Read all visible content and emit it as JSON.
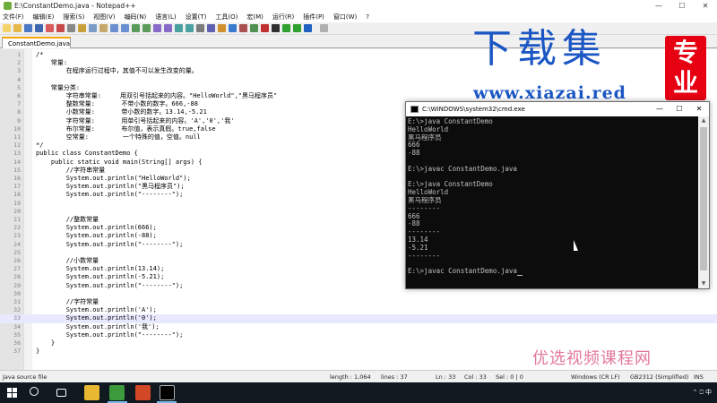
{
  "notepad": {
    "title": "E:\\ConstantDemo.java - Notepad++",
    "win_buttons": [
      "—",
      "☐",
      "✕"
    ],
    "menu": [
      "文件(F)",
      "编辑(E)",
      "搜索(S)",
      "视图(V)",
      "编码(N)",
      "语言(L)",
      "设置(T)",
      "工具(O)",
      "宏(M)",
      "运行(R)",
      "插件(P)",
      "窗口(W)",
      "?"
    ],
    "tab": "ConstantDemo.java",
    "lines": [
      {
        "n": "1",
        "t": "/*",
        "cls": "c-comment"
      },
      {
        "n": "2",
        "t": "    常量:",
        "cls": "c-comment"
      },
      {
        "n": "3",
        "t": "        在程序运行过程中，其值不可以发生改变的量。",
        "cls": "c-comment"
      },
      {
        "n": "4",
        "t": "",
        "cls": "c-comment"
      },
      {
        "n": "5",
        "t": "    常量分类:",
        "cls": "c-comment"
      },
      {
        "n": "6",
        "t": "        字符串常量:     用双引号括起来的内容。\"HelloWorld\",\"黑马程序员\"",
        "cls": "c-comment"
      },
      {
        "n": "7",
        "t": "        整数常量:       不带小数的数字。666,-88",
        "cls": "c-comment"
      },
      {
        "n": "8",
        "t": "        小数常量:       带小数的数字。13.14,-5.21",
        "cls": "c-comment"
      },
      {
        "n": "9",
        "t": "        字符常量:       用单引号括起来的内容。'A','0','我'",
        "cls": "c-comment"
      },
      {
        "n": "10",
        "t": "        布尔常量:       布尔值，表示真假。true,false",
        "cls": "c-comment"
      },
      {
        "n": "11",
        "t": "        空常量:         一个特殊的值，空值。null",
        "cls": "c-comment"
      },
      {
        "n": "12",
        "t": "*/",
        "cls": "c-comment"
      },
      {
        "n": "13",
        "t": "public class ConstantDemo {",
        "cls": ""
      },
      {
        "n": "14",
        "t": "    public static void main(String[] args) {",
        "cls": ""
      },
      {
        "n": "15",
        "t": "        //字符串常量",
        "cls": "c-comment"
      },
      {
        "n": "16",
        "t": "        System.out.println(\"HelloWorld\");",
        "cls": ""
      },
      {
        "n": "17",
        "t": "        System.out.println(\"黑马程序员\");",
        "cls": ""
      },
      {
        "n": "18",
        "t": "        System.out.println(\"--------\");",
        "cls": ""
      },
      {
        "n": "19",
        "t": "",
        "cls": ""
      },
      {
        "n": "20",
        "t": "",
        "cls": ""
      },
      {
        "n": "21",
        "t": "        //整数常量",
        "cls": "c-comment"
      },
      {
        "n": "22",
        "t": "        System.out.println(666);",
        "cls": ""
      },
      {
        "n": "23",
        "t": "        System.out.println(-88);",
        "cls": ""
      },
      {
        "n": "24",
        "t": "        System.out.println(\"--------\");",
        "cls": ""
      },
      {
        "n": "25",
        "t": "",
        "cls": ""
      },
      {
        "n": "26",
        "t": "        //小数常量",
        "cls": "c-comment"
      },
      {
        "n": "27",
        "t": "        System.out.println(13.14);",
        "cls": ""
      },
      {
        "n": "28",
        "t": "        System.out.println(-5.21);",
        "cls": ""
      },
      {
        "n": "29",
        "t": "        System.out.println(\"--------\");",
        "cls": ""
      },
      {
        "n": "30",
        "t": "",
        "cls": ""
      },
      {
        "n": "31",
        "t": "        //字符常量",
        "cls": "c-comment"
      },
      {
        "n": "32",
        "t": "        System.out.println('A');",
        "cls": ""
      },
      {
        "n": "33",
        "t": "        System.out.println('0');",
        "cls": "current"
      },
      {
        "n": "34",
        "t": "        System.out.println('我');",
        "cls": ""
      },
      {
        "n": "35",
        "t": "        System.out.println(\"--------\");",
        "cls": ""
      },
      {
        "n": "36",
        "t": "    }",
        "cls": ""
      },
      {
        "n": "37",
        "t": "}",
        "cls": ""
      }
    ],
    "status": {
      "type": "Java source file",
      "length": "length : 1,064",
      "lines": "lines : 37",
      "ln": "Ln : 33",
      "col": "Col : 33",
      "sel": "Sel : 0 | 0",
      "eol": "Windows (CR LF)",
      "encoding": "GB2312 (Simplified)",
      "mode": "INS"
    }
  },
  "cmd": {
    "title": "C:\\WINDOWS\\system32\\cmd.exe",
    "win_buttons": [
      "—",
      "☐",
      "✕"
    ],
    "output": [
      "E:\\>java ConstantDemo",
      "HelloWorld",
      "黑马程序员",
      "666",
      "-88",
      "",
      "E:\\>javac ConstantDemo.java",
      "",
      "E:\\>java ConstantDemo",
      "HelloWorld",
      "黑马程序员",
      "--------",
      "666",
      "-88",
      "--------",
      "13.14",
      "-5.21",
      "--------",
      "",
      "E:\\>javac ConstantDemo.java"
    ]
  },
  "watermark": {
    "title": "下载集",
    "url": "www.xiazai.red",
    "seal": "专业",
    "course": "优选视频课程网"
  },
  "taskbar": {
    "tray": "⌃  ⎕  中"
  }
}
